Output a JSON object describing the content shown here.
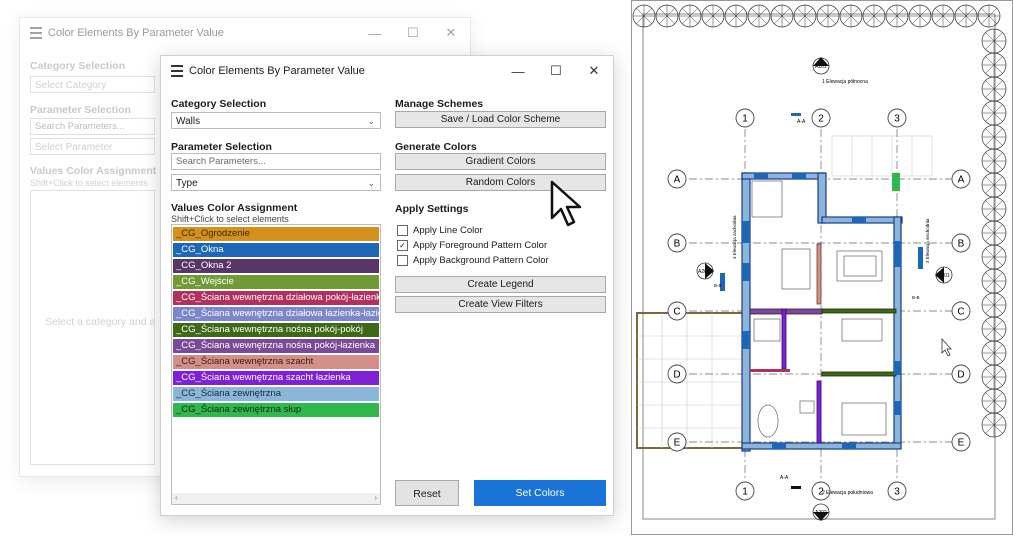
{
  "back_window": {
    "title": "Color Elements By Parameter Value",
    "category_label": "Category Selection",
    "category_placeholder": "Select Category",
    "parameter_label": "Parameter Selection",
    "search_placeholder": "Search Parameters...",
    "parameter_placeholder": "Select Parameter",
    "values_label": "Values Color Assignment",
    "values_hint": "Shift+Click to select elements",
    "empty_message": "Select a category and a parameter value"
  },
  "window": {
    "title": "Color Elements By Parameter Value",
    "minimize": "—",
    "maximize": "☐",
    "close": "✕"
  },
  "category": {
    "label": "Category Selection",
    "value": "Walls"
  },
  "parameter": {
    "label": "Parameter Selection",
    "search_placeholder": "Search Parameters...",
    "value": "Type"
  },
  "values": {
    "label": "Values Color Assignment",
    "hint": "Shift+Click to select elements",
    "items": [
      {
        "text": "_CG_Ogrodzenie",
        "color": "#d4921c",
        "fg": "#3a2a00"
      },
      {
        "text": "_CG_Okna",
        "color": "#1d67b8",
        "fg": "#ffffff"
      },
      {
        "text": "_CG_Okna 2",
        "color": "#5a3668",
        "fg": "#ffffff"
      },
      {
        "text": "_CG_Wejście",
        "color": "#6f9a34",
        "fg": "#ffffff"
      },
      {
        "text": "_CG_Ściana wewnętrzna działowa pokój-łazienka",
        "color": "#b2305e",
        "fg": "#ffffff"
      },
      {
        "text": "_CG_Ściana wewnętrzna działowa łazienka-łazienka",
        "color": "#7c86cc",
        "fg": "#ffffff"
      },
      {
        "text": "_CG_Ściana wewnętrzna nośna pokój-pokój",
        "color": "#3e6a18",
        "fg": "#ffffff"
      },
      {
        "text": "_CG_Ściana wewnętrzna nośna pokój-łazienka",
        "color": "#7a4a96",
        "fg": "#ffffff"
      },
      {
        "text": "_CG_Ściana wewnętrzna szacht",
        "color": "#d49088",
        "fg": "#3a1a14"
      },
      {
        "text": "_CG_Ściana wewnętrzna szacht łazienka",
        "color": "#7f1fd6",
        "fg": "#ffffff"
      },
      {
        "text": "_CG_Ściana zewnętrzna",
        "color": "#8ab6dc",
        "fg": "#1a2a3a"
      },
      {
        "text": "_CG_Ściana zewnętrzna słup",
        "color": "#2fb84c",
        "fg": "#0d2a12"
      }
    ]
  },
  "manage": {
    "label": "Manage Schemes",
    "save_load": "Save / Load Color Scheme"
  },
  "generate": {
    "label": "Generate Colors",
    "gradient": "Gradient Colors",
    "random": "Random Colors"
  },
  "apply": {
    "label": "Apply Settings",
    "line": {
      "text": "Apply Line Color",
      "checked": false
    },
    "foreground": {
      "text": "Apply Foreground Pattern Color",
      "checked": true
    },
    "background": {
      "text": "Apply Background Pattern Color",
      "checked": false
    },
    "create_legend": "Create Legend",
    "create_filters": "Create View Filters"
  },
  "actions": {
    "reset": "Reset",
    "set_colors": "Set Colors",
    "accent": "#1a73d6"
  },
  "plan": {
    "grid_numbers": [
      "1",
      "2",
      "3"
    ],
    "grid_letters": [
      "A",
      "B",
      "C",
      "D",
      "E"
    ],
    "section_top": "A-A",
    "section_bottom": "A-A",
    "tag_top": "A201",
    "tag_left": "A202",
    "tag_right": "A201",
    "tag_bottom": "A202",
    "elev_top": "1 Elewacja północna",
    "elev_bottom": "2 Elewacja południowa",
    "elev_left": "4 Elewacja zachodnia",
    "elev_right": "3 Elewacja wschodnia",
    "cut_left": "B-B",
    "cut_right": "B-B"
  }
}
